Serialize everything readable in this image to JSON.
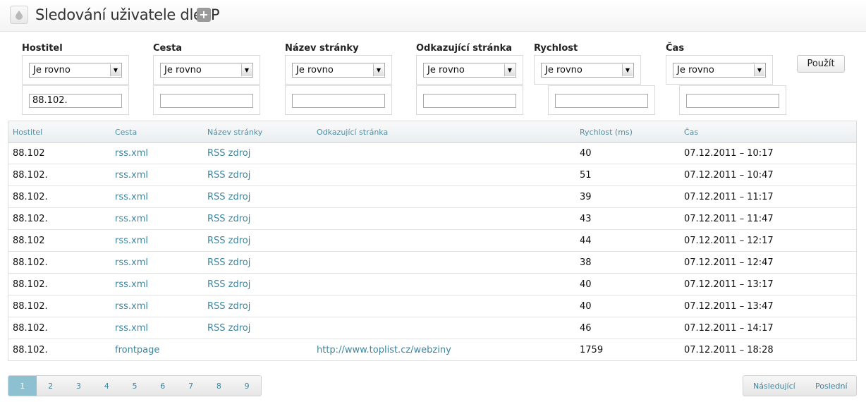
{
  "header": {
    "title": "Sledování uživatele dle IP",
    "add_label": "+"
  },
  "filters": [
    {
      "label": "Hostitel",
      "operator": "Je rovno",
      "value": "88.102."
    },
    {
      "label": "Cesta",
      "operator": "Je rovno",
      "value": ""
    },
    {
      "label": "Název stránky",
      "operator": "Je rovno",
      "value": ""
    },
    {
      "label": "Odkazující stránka",
      "operator": "Je rovno",
      "value": ""
    },
    {
      "label": "Rychlost",
      "operator": "Je rovno",
      "value": ""
    },
    {
      "label": "Čas",
      "operator": "Je rovno",
      "value": ""
    }
  ],
  "apply_label": "Použít",
  "table": {
    "columns": [
      "Hostitel",
      "Cesta",
      "Název stránky",
      "Odkazující stránka",
      "Rychlost (ms)",
      "Čas"
    ],
    "rows": [
      {
        "host": "88.102",
        "path": "rss.xml",
        "name": "RSS zdroj",
        "ref": "",
        "speed": "40",
        "time": "07.12.2011 – 10:17"
      },
      {
        "host": "88.102.",
        "path": "rss.xml",
        "name": "RSS zdroj",
        "ref": "",
        "speed": "51",
        "time": "07.12.2011 – 10:47"
      },
      {
        "host": "88.102.",
        "path": "rss.xml",
        "name": "RSS zdroj",
        "ref": "",
        "speed": "39",
        "time": "07.12.2011 – 11:17"
      },
      {
        "host": "88.102.",
        "path": "rss.xml",
        "name": "RSS zdroj",
        "ref": "",
        "speed": "43",
        "time": "07.12.2011 – 11:47"
      },
      {
        "host": "88.102",
        "path": "rss.xml",
        "name": "RSS zdroj",
        "ref": "",
        "speed": "44",
        "time": "07.12.2011 – 12:17"
      },
      {
        "host": "88.102.",
        "path": "rss.xml",
        "name": "RSS zdroj",
        "ref": "",
        "speed": "38",
        "time": "07.12.2011 – 12:47"
      },
      {
        "host": "88.102.",
        "path": "rss.xml",
        "name": "RSS zdroj",
        "ref": "",
        "speed": "40",
        "time": "07.12.2011 – 13:17"
      },
      {
        "host": "88.102.",
        "path": "rss.xml",
        "name": "RSS zdroj",
        "ref": "",
        "speed": "40",
        "time": "07.12.2011 – 13:47"
      },
      {
        "host": "88.102.",
        "path": "rss.xml",
        "name": "RSS zdroj",
        "ref": "",
        "speed": "46",
        "time": "07.12.2011 – 14:17"
      },
      {
        "host": "88.102.",
        "path": "frontpage",
        "name": "",
        "ref": "http://www.toplist.cz/webziny",
        "speed": "1759",
        "time": "07.12.2011 – 18:28"
      }
    ]
  },
  "pagination": {
    "pages": [
      "1",
      "2",
      "3",
      "4",
      "5",
      "6",
      "7",
      "8",
      "9"
    ],
    "active": "1",
    "next_label": "Následující",
    "last_label": "Poslední"
  },
  "colors": {
    "link": "#3d86a0",
    "active_page": "#8dc1d1",
    "header_text": "#4f8fa5"
  },
  "icons": {
    "title_icon": "drop-icon",
    "add_icon": "plus-icon",
    "select_arrow": "chevron-down-icon"
  }
}
